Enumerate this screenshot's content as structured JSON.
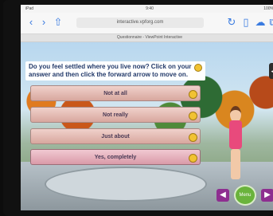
{
  "status": {
    "left": "iPad",
    "time": "9:40",
    "battery": "100%"
  },
  "browser": {
    "url": "interactive.vpforg.com",
    "tab_title": "Questionnaire - ViewPoint Interactive"
  },
  "question": {
    "text": "Do you feel settled where you live now? Click on your answer and then click the forward arrow to move on."
  },
  "answers": [
    {
      "label": "Not at all"
    },
    {
      "label": "Not really"
    },
    {
      "label": "Just about"
    },
    {
      "label": "Yes, completely",
      "selected": true
    }
  ],
  "nav": {
    "menu_label": "Menu"
  },
  "colors": {
    "accent_purple": "#8e2e90",
    "menu_green": "#6ab33c",
    "question_text": "#233a6a"
  }
}
